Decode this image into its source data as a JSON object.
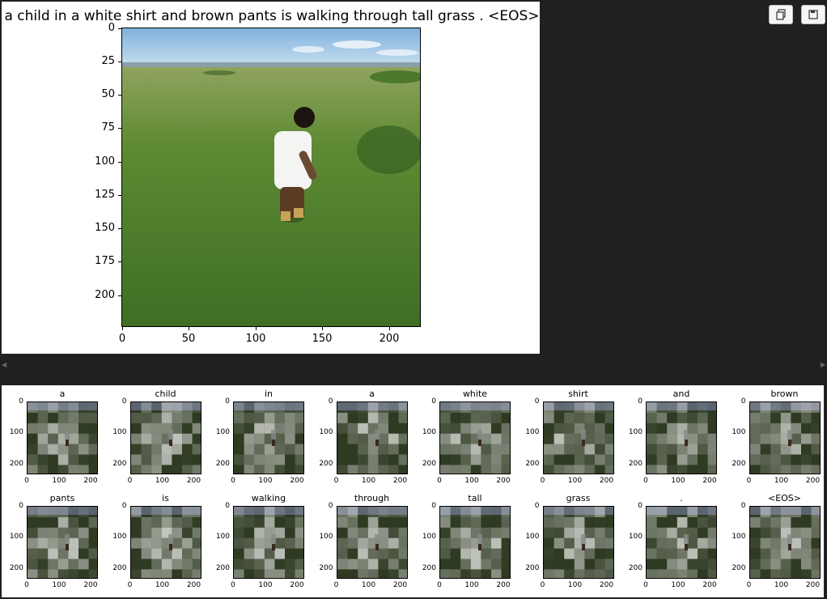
{
  "main_figure": {
    "title": "a child in a white shirt and brown pants is walking through tall grass . <EOS>",
    "y_ticks": [
      "0",
      "25",
      "50",
      "75",
      "100",
      "125",
      "150",
      "175",
      "200"
    ],
    "x_ticks": [
      "0",
      "50",
      "100",
      "150",
      "200"
    ]
  },
  "toolbar": {
    "copy_icon": "copy-icon",
    "save_icon": "save-icon"
  },
  "attention_grid": {
    "y_ticks": [
      "0",
      "100",
      "200"
    ],
    "x_ticks": [
      "0",
      "100",
      "200"
    ],
    "words": [
      "a",
      "child",
      "in",
      "a",
      "white",
      "shirt",
      "and",
      "brown",
      "pants",
      "is",
      "walking",
      "through",
      "tall",
      "grass",
      ".",
      "<EOS>"
    ]
  }
}
